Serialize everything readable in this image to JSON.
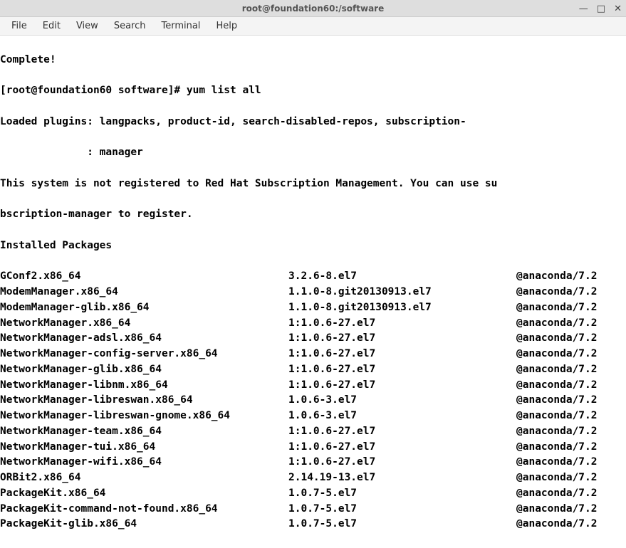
{
  "window": {
    "title": "root@foundation60:/software",
    "controls": {
      "minimize": "—",
      "maximize": "□",
      "close": "✕"
    }
  },
  "menu": {
    "file": "File",
    "edit": "Edit",
    "view": "View",
    "search": "Search",
    "terminal": "Terminal",
    "help": "Help"
  },
  "term": {
    "line0": "Complete!",
    "line1": "[root@foundation60 software]# yum list all",
    "line2": "Loaded plugins: langpacks, product-id, search-disabled-repos, subscription-",
    "line3": "              : manager",
    "line4": "This system is not registered to Red Hat Subscription Management. You can use su",
    "line5": "bscription-manager to register.",
    "line6": "Installed Packages"
  },
  "packages": [
    {
      "name": "GConf2.x86_64",
      "version": "3.2.6-8.el7",
      "repo": "@anaconda/7.2"
    },
    {
      "name": "ModemManager.x86_64",
      "version": "1.1.0-8.git20130913.el7",
      "repo": "@anaconda/7.2"
    },
    {
      "name": "ModemManager-glib.x86_64",
      "version": "1.1.0-8.git20130913.el7",
      "repo": "@anaconda/7.2"
    },
    {
      "name": "NetworkManager.x86_64",
      "version": "1:1.0.6-27.el7",
      "repo": "@anaconda/7.2"
    },
    {
      "name": "NetworkManager-adsl.x86_64",
      "version": "1:1.0.6-27.el7",
      "repo": "@anaconda/7.2"
    },
    {
      "name": "NetworkManager-config-server.x86_64",
      "version": "1:1.0.6-27.el7",
      "repo": "@anaconda/7.2"
    },
    {
      "name": "NetworkManager-glib.x86_64",
      "version": "1:1.0.6-27.el7",
      "repo": "@anaconda/7.2"
    },
    {
      "name": "NetworkManager-libnm.x86_64",
      "version": "1:1.0.6-27.el7",
      "repo": "@anaconda/7.2"
    },
    {
      "name": "NetworkManager-libreswan.x86_64",
      "version": "1.0.6-3.el7",
      "repo": "@anaconda/7.2"
    },
    {
      "name": "NetworkManager-libreswan-gnome.x86_64",
      "version": "1.0.6-3.el7",
      "repo": "@anaconda/7.2"
    },
    {
      "name": "NetworkManager-team.x86_64",
      "version": "1:1.0.6-27.el7",
      "repo": "@anaconda/7.2"
    },
    {
      "name": "NetworkManager-tui.x86_64",
      "version": "1:1.0.6-27.el7",
      "repo": "@anaconda/7.2"
    },
    {
      "name": "NetworkManager-wifi.x86_64",
      "version": "1:1.0.6-27.el7",
      "repo": "@anaconda/7.2"
    },
    {
      "name": "ORBit2.x86_64",
      "version": "2.14.19-13.el7",
      "repo": "@anaconda/7.2"
    },
    {
      "name": "PackageKit.x86_64",
      "version": "1.0.7-5.el7",
      "repo": "@anaconda/7.2"
    },
    {
      "name": "PackageKit-command-not-found.x86_64",
      "version": "1.0.7-5.el7",
      "repo": "@anaconda/7.2"
    },
    {
      "name": "PackageKit-glib.x86_64",
      "version": "1.0.7-5.el7",
      "repo": "@anaconda/7.2"
    }
  ]
}
